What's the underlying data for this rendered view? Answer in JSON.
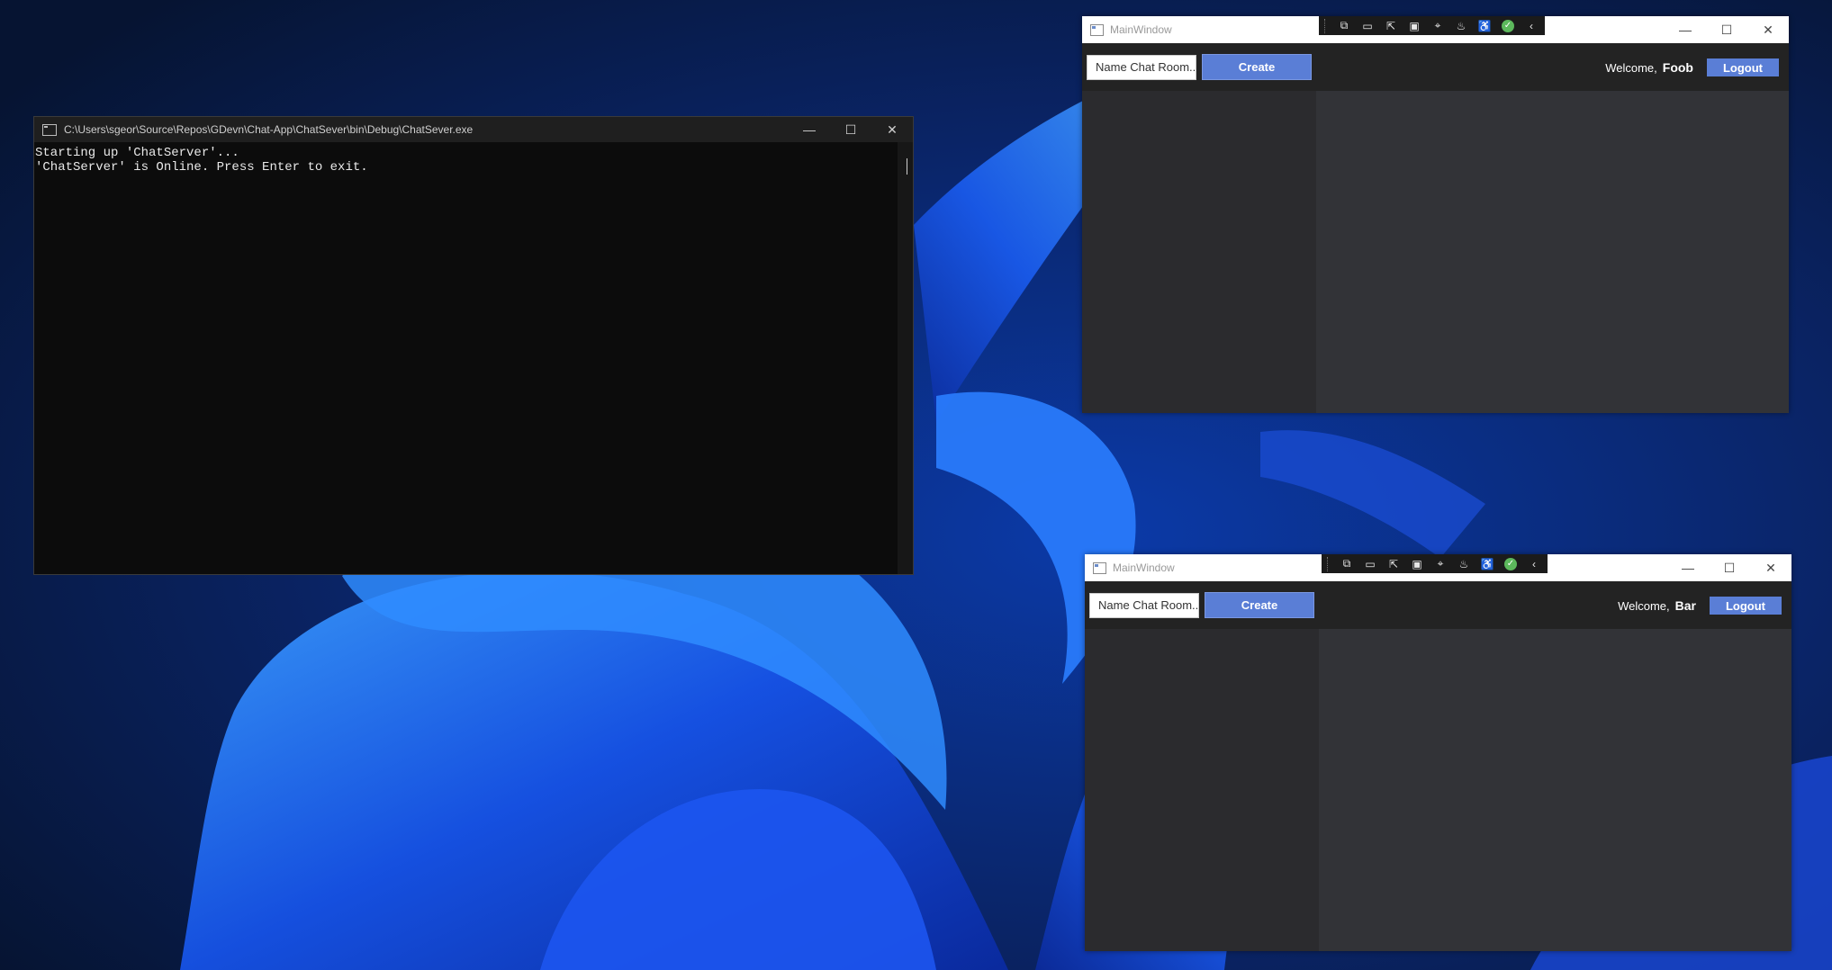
{
  "colors": {
    "desktop_bg": "#071a44",
    "ribbon_blue": "#1a4fe0",
    "console_bg": "#0c0c0c",
    "chat_header": "#232323",
    "chat_rooms": "#2b2b2e",
    "chat_messages": "#323337",
    "accent_button": "#5a7ed6"
  },
  "console": {
    "title": "C:\\Users\\sgeor\\Source\\Repos\\GDevn\\Chat-App\\ChatSever\\bin\\Debug\\ChatSever.exe",
    "lines": [
      "Starting up 'ChatServer'...",
      "'ChatServer' is Online. Press Enter to exit."
    ]
  },
  "window_controls": {
    "minimize": "—",
    "maximize": "☐",
    "close": "✕"
  },
  "chat_windows": [
    {
      "title": "MainWindow",
      "room_input_placeholder": "Name Chat Room...",
      "create_label": "Create",
      "welcome_label": "Welcome,",
      "username": "Foob",
      "logout_label": "Logout"
    },
    {
      "title": "MainWindow",
      "room_input_placeholder": "Name Chat Room...",
      "create_label": "Create",
      "welcome_label": "Welcome,",
      "username": "Bar",
      "logout_label": "Logout"
    }
  ],
  "debug_toolbar": {
    "icons": [
      "live-visual-tree-icon",
      "record-icon",
      "select-element-icon",
      "display-layout-adorners-icon",
      "track-focus-icon",
      "hot-reload-icon",
      "accessibility-icon",
      "binding-check-icon",
      "collapse-toolbar-icon"
    ]
  }
}
